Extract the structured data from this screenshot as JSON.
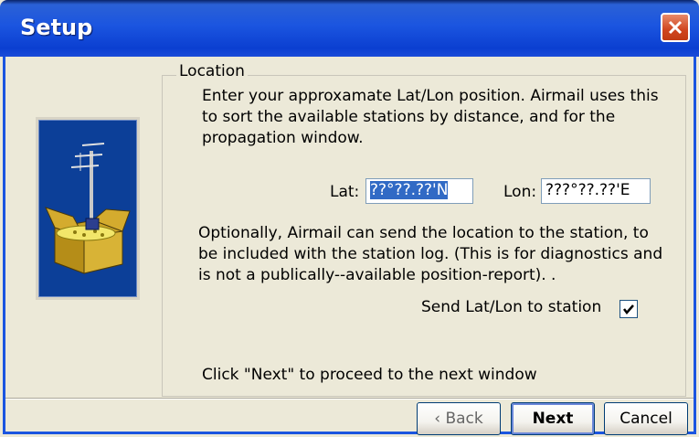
{
  "window": {
    "title": "Setup"
  },
  "group": {
    "label": "Location"
  },
  "text": {
    "intro_line1": "Enter your approxamate Lat/Lon position. Airmail uses this",
    "intro_line2": "to sort the available stations by distance, and for the",
    "intro_line3": "propagation window.",
    "optional_line1": "Optionally, Airmail can send the location to the station, to",
    "optional_line2": "be included with the station log. (This is for diagnostics and",
    "optional_line3": "is not a publically--available position-report). .",
    "click_next": "Click \"Next\" to proceed to the next window"
  },
  "fields": {
    "lat_label": "Lat:",
    "lat_value": "??°??.??'N",
    "lon_label": "Lon:",
    "lon_value": "???°??.??'E"
  },
  "checkbox": {
    "label": "Send Lat/Lon to station",
    "checked": true
  },
  "buttons": {
    "back": "‹ Back",
    "next": "Next",
    "cancel": "Cancel"
  },
  "icons": {
    "close": "close-icon",
    "checkmark": "checkmark-icon",
    "antenna_box": "antenna-box-icon"
  },
  "colors": {
    "titlebar": "#0b3fd1",
    "art_panel": "#0c3f98",
    "selection": "#316ac5",
    "close_button": "#d0451f"
  }
}
